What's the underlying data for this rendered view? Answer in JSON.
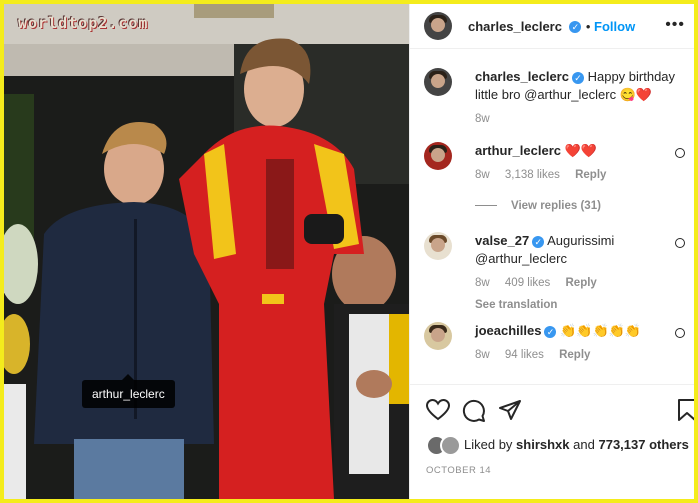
{
  "photo": {
    "watermark": "worldtop2.com",
    "tag_label": "arthur_leclerc"
  },
  "header": {
    "username": "charles_leclerc",
    "follow_label": "Follow",
    "more_icon": "more-options-icon"
  },
  "caption": {
    "username": "charles_leclerc",
    "text": "Happy birthday little bro @arthur_leclerc 😋❤️",
    "age": "8w"
  },
  "comments": [
    {
      "username": "arthur_leclerc",
      "text": "❤️❤️",
      "age": "8w",
      "likes": "3,138 likes",
      "reply": "Reply",
      "verified": false
    },
    {
      "username": "valse_27",
      "text": "Augurissimi @arthur_leclerc",
      "age": "8w",
      "likes": "409 likes",
      "reply": "Reply",
      "translate": "See translation",
      "verified": true
    },
    {
      "username": "joeachilles",
      "text": "👏👏👏👏👏",
      "age": "8w",
      "likes": "94 likes",
      "reply": "Reply",
      "verified": true
    }
  ],
  "view_replies": "View replies (31)",
  "liked_by": {
    "prefix": "Liked by",
    "user": "shirshxk",
    "and": "and",
    "others": "773,137 others"
  },
  "post_date": "OCTOBER 14",
  "colors": {
    "frame": "#f4ec1c",
    "accent": "#0095f6",
    "verified": "#3897f0",
    "muted": "#8e8e8e"
  }
}
